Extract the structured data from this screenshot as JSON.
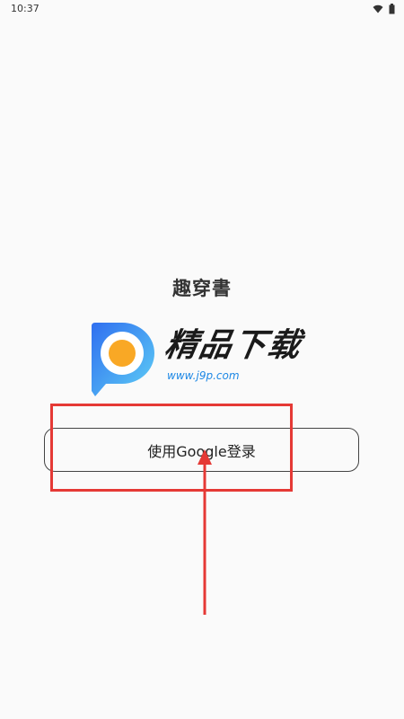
{
  "status_bar": {
    "time": "10:37",
    "icons": [
      "wifi-icon",
      "battery-icon"
    ]
  },
  "app": {
    "title": "趣穿書"
  },
  "logo": {
    "text": "精品下载",
    "url": "www.j9p.com",
    "colors": {
      "p_blue": "#2f8ff0",
      "p_light": "#5fd0f5",
      "dot_orange": "#f9a825"
    }
  },
  "login": {
    "google_label": "使用Google登录"
  },
  "annotation": {
    "color": "#e53935"
  }
}
